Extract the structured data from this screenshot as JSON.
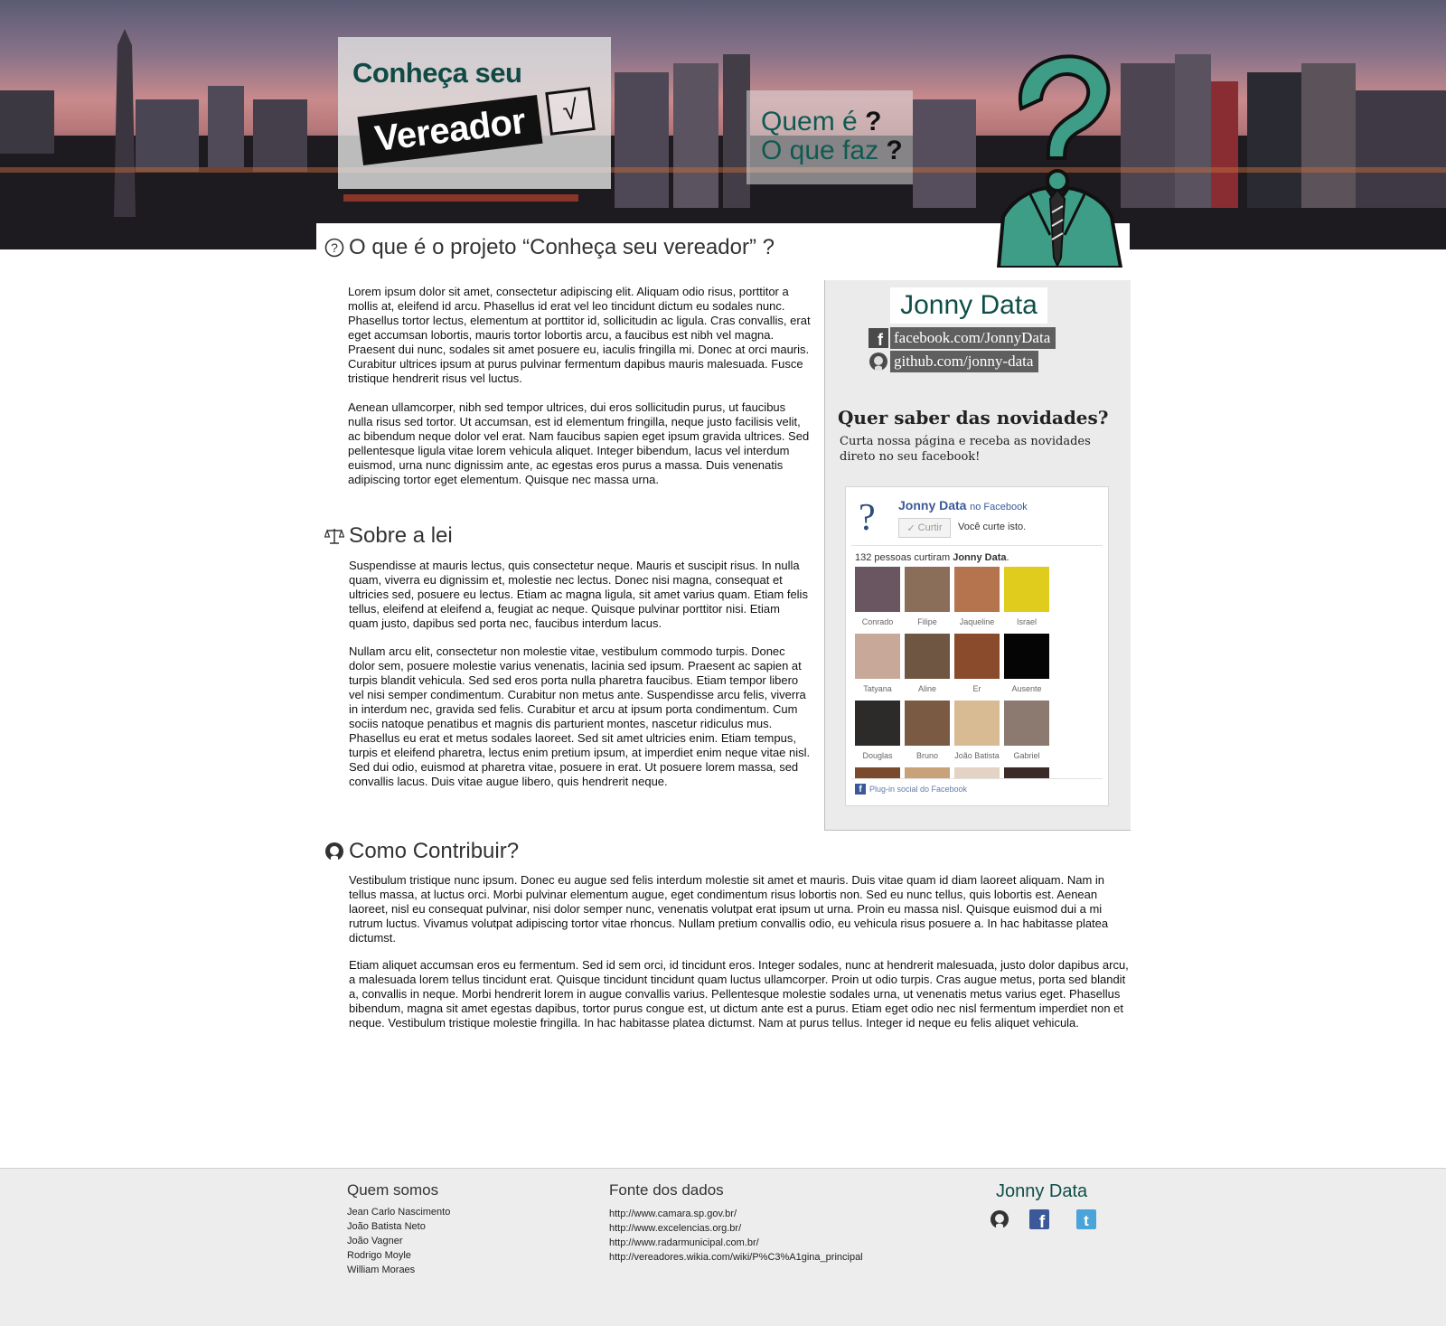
{
  "header": {
    "logo_line1": "Conheça seu",
    "logo_tag": "Vereador",
    "logo_check": "√",
    "quem_line1": "Quem é",
    "quem_line2": "O que faz",
    "qmark": "?"
  },
  "sections": {
    "projeto": {
      "title": "O que é o projeto “Conheça seu vereador” ?",
      "paragraphs": [
        "Lorem ipsum dolor sit amet, consectetur adipiscing elit. Aliquam odio risus, porttitor a mollis at, eleifend id arcu. Phasellus id erat vel leo tincidunt dictum eu sodales nunc. Phasellus tortor lectus, elementum at porttitor id, sollicitudin ac ligula. Cras convallis, erat eget accumsan lobortis, mauris tortor lobortis arcu, a faucibus est nibh vel magna. Praesent dui nunc, sodales sit amet posuere eu, iaculis fringilla mi. Donec at orci mauris. Curabitur ultrices ipsum at purus pulvinar fermentum dapibus mauris malesuada. Fusce tristique hendrerit risus vel luctus.",
        "Aenean ullamcorper, nibh sed tempor ultrices, dui eros sollicitudin purus, ut faucibus nulla risus sed tortor. Ut accumsan, est id elementum fringilla, neque justo facilisis velit, ac bibendum neque dolor vel erat. Nam faucibus sapien eget ipsum gravida ultrices. Sed pellentesque ligula vitae lorem vehicula aliquet. Integer bibendum, lacus vel interdum euismod, urna nunc dignissim ante, ac egestas eros purus a massa. Duis venenatis adipiscing tortor eget elementum. Quisque nec massa urna."
      ]
    },
    "lei": {
      "title": "Sobre a lei",
      "paragraphs": [
        "Suspendisse at mauris lectus, quis consectetur neque. Mauris et suscipit risus. In nulla quam, viverra eu dignissim et, molestie nec lectus. Donec nisi magna, consequat et ultricies sed, posuere eu lectus. Etiam ac magna ligula, sit amet varius quam. Etiam felis tellus, eleifend at eleifend a, feugiat ac neque. Quisque pulvinar porttitor nisi. Etiam quam justo, dapibus sed porta nec, faucibus interdum lacus.",
        "Nullam arcu elit, consectetur non molestie vitae, vestibulum commodo turpis. Donec dolor sem, posuere molestie varius venenatis, lacinia sed ipsum. Praesent ac sapien at turpis blandit vehicula. Sed sed eros porta nulla pharetra faucibus. Etiam tempor libero vel nisi semper condimentum. Curabitur non metus ante. Suspendisse arcu felis, viverra in interdum nec, gravida sed felis. Curabitur et arcu at ipsum porta condimentum. Cum sociis natoque penatibus et magnis dis parturient montes, nascetur ridiculus mus. Phasellus eu erat et metus sodales laoreet. Sed sit amet ultricies enim. Etiam tempus, turpis et eleifend pharetra, lectus enim pretium ipsum, at imperdiet enim neque vitae nisl. Sed dui odio, euismod at pharetra vitae, posuere in erat. Ut posuere lorem massa, sed convallis lacus. Duis vitae augue libero, quis hendrerit neque."
      ]
    },
    "contribuir": {
      "title": "Como Contribuir?",
      "paragraphs": [
        "Vestibulum tristique nunc ipsum. Donec eu augue sed felis interdum molestie sit amet et mauris. Duis vitae quam id diam laoreet aliquam. Nam in tellus massa, at luctus orci. Morbi pulvinar elementum augue, eget condimentum risus lobortis non. Sed eu nunc tellus, quis lobortis est. Aenean laoreet, nisl eu consequat pulvinar, nisi dolor semper nunc, venenatis volutpat erat ipsum ut urna. Proin eu massa nisl. Quisque euismod dui a mi rutrum luctus. Vivamus volutpat adipiscing tortor vitae rhoncus. Nullam pretium convallis odio, eu vehicula risus posuere a. In hac habitasse platea dictumst.",
        "Etiam aliquet accumsan eros eu fermentum. Sed id sem orci, id tincidunt eros. Integer sodales, nunc at hendrerit malesuada, justo dolor dapibus arcu, a malesuada lorem tellus tincidunt erat. Quisque tincidunt tincidunt quam luctus ullamcorper. Proin ut odio turpis. Cras augue metus, porta sed blandit a, convallis in neque. Morbi hendrerit lorem in augue convallis varius. Pellentesque molestie sodales urna, ut venenatis metus varius eget. Phasellus bibendum, magna sit amet egestas dapibus, tortor purus congue est, ut dictum ante est a purus. Etiam eget odio nec nisl fermentum imperdiet non et neque. Vestibulum tristique molestie fringilla. In hac habitasse platea dictumst. Nam at purus tellus. Integer id neque eu felis aliquet vehicula."
      ]
    }
  },
  "sidebar": {
    "name": "Jonny Data",
    "facebook_link": "facebook.com/JonnyData",
    "github_link": "github.com/jonny-data",
    "heading": "Quer saber das novidades?",
    "subtext": "Curta nossa página e receba as novidades direto no seu facebook!",
    "fb": {
      "page_name": "Jonny Data",
      "on_facebook": "no Facebook",
      "like_button": "Curtir",
      "you_like": "Você curte isto.",
      "count_prefix": "132 pessoas curtiram ",
      "count_name": "Jonny Data",
      "count_suffix": ".",
      "fans": [
        {
          "name": "Conrado",
          "color": "#6a5660"
        },
        {
          "name": "Filipe",
          "color": "#8a6e5a"
        },
        {
          "name": "Jaqueline",
          "color": "#b5744d"
        },
        {
          "name": "Israel",
          "color": "#e0cc1c"
        },
        {
          "name": "Tatyana",
          "color": "#c8a999"
        },
        {
          "name": "Aline",
          "color": "#6f5642"
        },
        {
          "name": "Er",
          "color": "#8a4a2c"
        },
        {
          "name": "Ausente",
          "color": "#050505"
        },
        {
          "name": "Douglas",
          "color": "#2d2a2a"
        },
        {
          "name": "Bruno",
          "color": "#7b5a43"
        },
        {
          "name": "João Batista",
          "color": "#d8bb93"
        },
        {
          "name": "Gabriel",
          "color": "#8c7a70"
        }
      ],
      "plugin_label": "Plug-in social do Facebook"
    }
  },
  "footer": {
    "quem_somos_title": "Quem somos",
    "quem_somos": [
      "Jean Carlo Nascimento",
      "João Batista Neto",
      "João Vagner",
      "Rodrigo Moyle",
      "William Moraes"
    ],
    "fonte_title": "Fonte dos dados",
    "fontes": [
      "http://www.camara.sp.gov.br/",
      "http://www.excelencias.org.br/",
      "http://www.radarmunicipal.com.br/",
      "http://vereadores.wikia.com/wiki/P%C3%A1gina_principal"
    ],
    "brand": "Jonny Data",
    "social_icons": [
      "github-icon",
      "facebook-icon",
      "twitter-icon"
    ]
  },
  "colors": {
    "brand_teal": "#0f4e48",
    "facebook_blue": "#3b5998",
    "twitter_blue": "#4aa3d9"
  }
}
